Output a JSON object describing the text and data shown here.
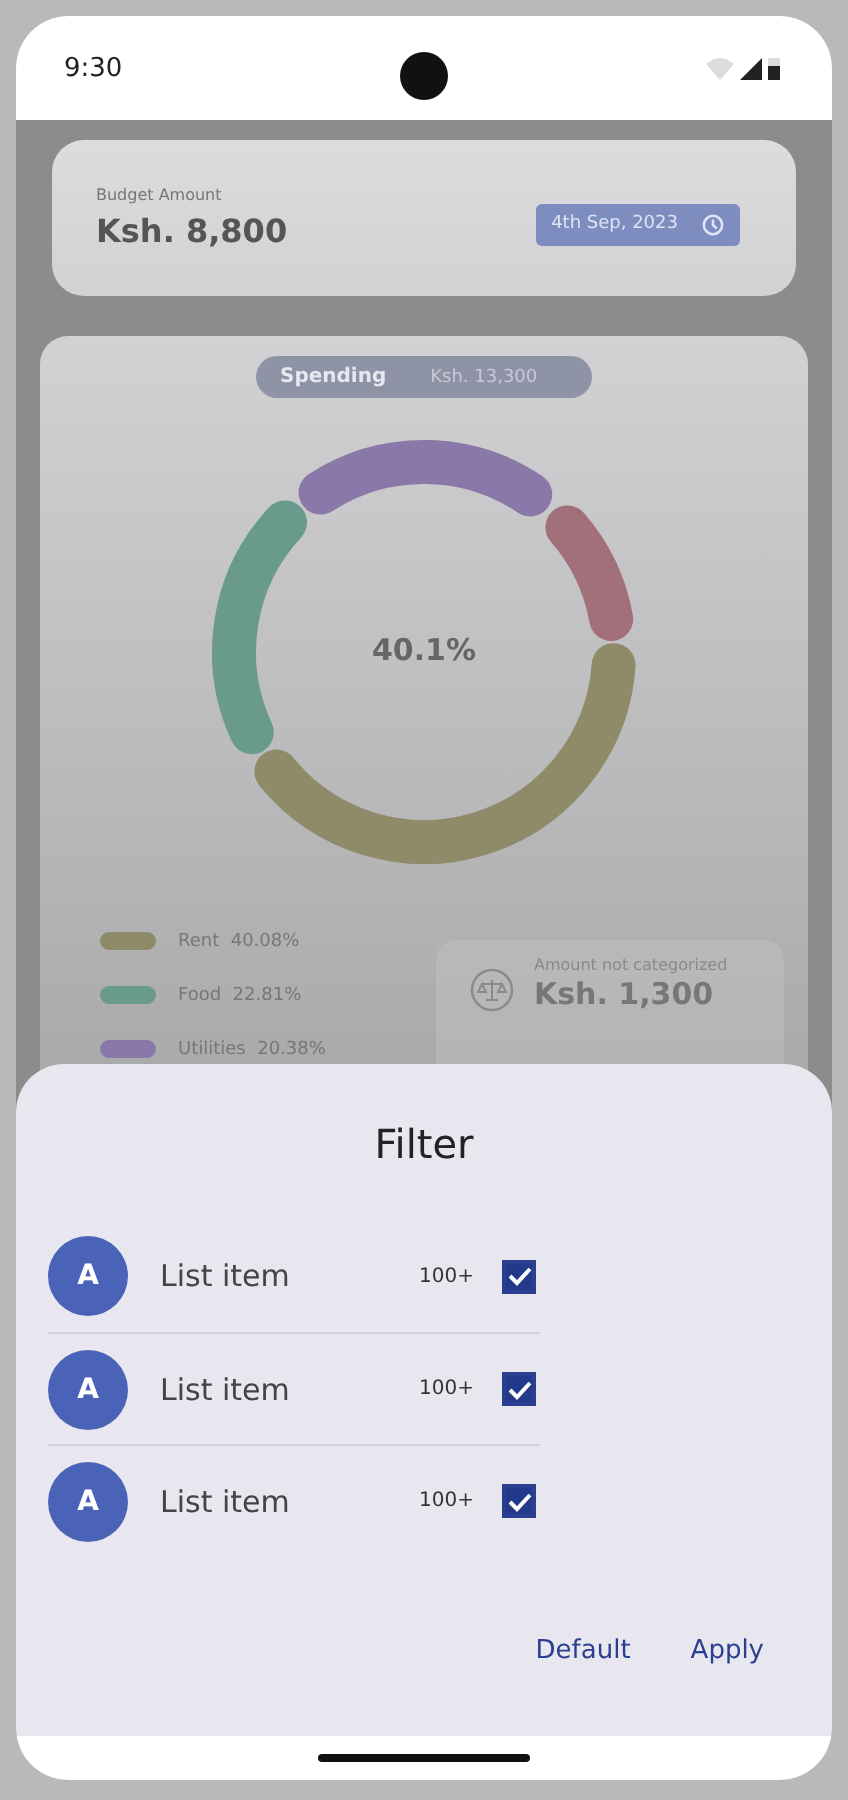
{
  "status_bar": {
    "time": "9:30"
  },
  "budget": {
    "label": "Budget Amount",
    "amount": "Ksh. 8,800",
    "date": "4th Sep, 2023"
  },
  "spending": {
    "label": "Spending",
    "amount": "Ksh. 13,300",
    "center_label": "40.1%",
    "legend": [
      {
        "name": "Rent",
        "share": "40.08%",
        "color": "#8f8a68"
      },
      {
        "name": "Food",
        "share": "22.81%",
        "color": "#6a9a8c"
      },
      {
        "name": "Utilities",
        "share": "20.38%",
        "color": "#8a78a8"
      }
    ],
    "uncategorized": {
      "label": "Amount not categorized",
      "amount": "Ksh. 1,300"
    }
  },
  "filter_sheet": {
    "title": "Filter",
    "items": [
      {
        "avatar": "A",
        "label": "List item",
        "count": "100+",
        "checked": true
      },
      {
        "avatar": "A",
        "label": "List item",
        "count": "100+",
        "checked": true
      },
      {
        "avatar": "A",
        "label": "List item",
        "count": "100+",
        "checked": true
      }
    ],
    "buttons": [
      "Default",
      "Apply"
    ]
  }
}
